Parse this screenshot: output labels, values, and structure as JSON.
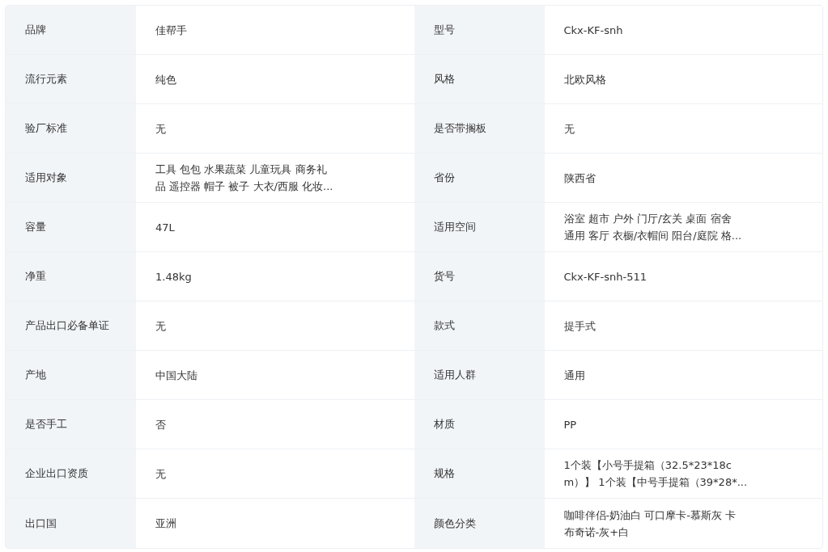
{
  "rows": [
    {
      "cells": [
        {
          "label": "品牌",
          "lines": [
            "佳帮手"
          ]
        },
        {
          "label": "型号",
          "lines": [
            "Ckx-KF-snh"
          ]
        }
      ]
    },
    {
      "cells": [
        {
          "label": "流行元素",
          "lines": [
            "纯色"
          ]
        },
        {
          "label": "风格",
          "lines": [
            "北欧风格"
          ]
        }
      ]
    },
    {
      "cells": [
        {
          "label": "验厂标准",
          "lines": [
            "无"
          ]
        },
        {
          "label": "是否带搁板",
          "lines": [
            "无"
          ]
        }
      ]
    },
    {
      "cells": [
        {
          "label": "适用对象",
          "lines": [
            "工具 包包 水果蔬菜 儿童玩具 商务礼",
            "品 遥控器 帽子 被子 大衣/西服 化妆..."
          ]
        },
        {
          "label": "省份",
          "lines": [
            "陕西省"
          ]
        }
      ]
    },
    {
      "cells": [
        {
          "label": "容量",
          "lines": [
            "47L"
          ]
        },
        {
          "label": "适用空间",
          "lines": [
            "浴室 超市 户外 门厅/玄关 桌面 宿舍",
            "通用 客厅 衣橱/衣帽间 阳台/庭院 格..."
          ]
        }
      ]
    },
    {
      "cells": [
        {
          "label": "净重",
          "lines": [
            "1.48kg"
          ]
        },
        {
          "label": "货号",
          "lines": [
            "Ckx-KF-snh-511"
          ]
        }
      ]
    },
    {
      "cells": [
        {
          "label": "产品出口必备单证",
          "lines": [
            "无"
          ]
        },
        {
          "label": "款式",
          "lines": [
            "提手式"
          ]
        }
      ]
    },
    {
      "cells": [
        {
          "label": "产地",
          "lines": [
            "中国大陆"
          ]
        },
        {
          "label": "适用人群",
          "lines": [
            "通用"
          ]
        }
      ]
    },
    {
      "cells": [
        {
          "label": "是否手工",
          "lines": [
            "否"
          ]
        },
        {
          "label": "材质",
          "lines": [
            "PP"
          ]
        }
      ]
    },
    {
      "cells": [
        {
          "label": "企业出口资质",
          "lines": [
            "无"
          ]
        },
        {
          "label": "规格",
          "lines": [
            "1个装【小号手提箱（32.5*23*18c",
            "m）】 1个装【中号手提箱（39*28*..."
          ]
        }
      ]
    },
    {
      "cells": [
        {
          "label": "出口国",
          "lines": [
            "亚洲"
          ]
        },
        {
          "label": "颜色分类",
          "lines": [
            "咖啡伴侣-奶油白 可口摩卡-慕斯灰 卡",
            "布奇诺-灰+白"
          ]
        }
      ]
    }
  ]
}
